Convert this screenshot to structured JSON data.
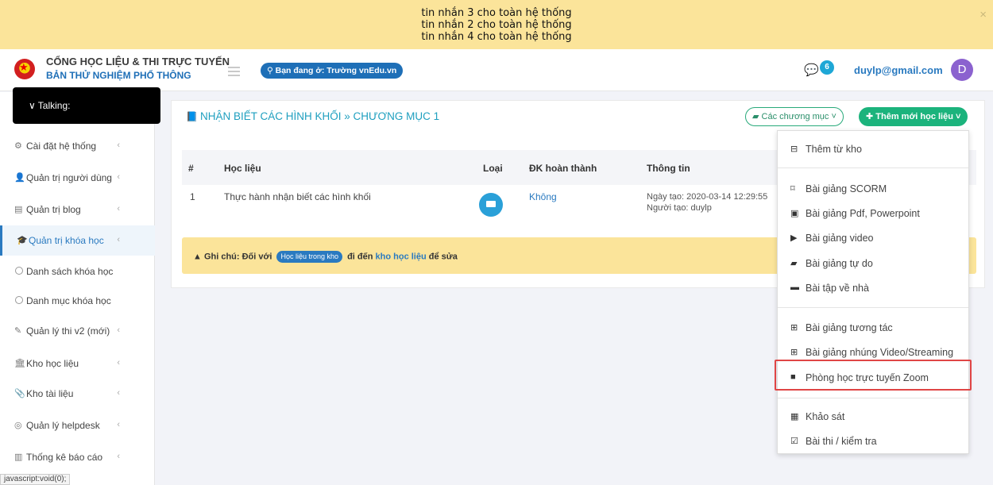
{
  "banner": {
    "lines": [
      "tin nhắn 3 cho toàn hệ thống",
      "tin nhắn 2 cho toàn hệ thống",
      "tin nhắn 4 cho toàn hệ thống"
    ],
    "close": "×"
  },
  "header": {
    "brand_line1": "CỔNG HỌC LIỆU & THI TRỰC TUYẾN",
    "brand_line2": "BẢN THỬ NGHIỆM PHỔ THÔNG",
    "location": "Bạn đang ở: Trường vnEdu.vn",
    "chat_count": "6",
    "user_email": "duylp@gmail.com",
    "avatar_letter": "D"
  },
  "sidebar": {
    "talking": "Talking:",
    "items": [
      {
        "label": "Cài đặt hệ thống",
        "icon": "gear-icon"
      },
      {
        "label": "Quản trị người dùng",
        "icon": "user-icon"
      },
      {
        "label": "Quản trị blog",
        "icon": "newspaper-icon"
      },
      {
        "label": "Quản trị khóa học",
        "icon": "graduation-cap-icon"
      },
      {
        "label": "Quản lý thi v2 (mới)",
        "icon": "edit-icon"
      },
      {
        "label": "Kho học liệu",
        "icon": "bank-icon"
      },
      {
        "label": "Kho tài liệu",
        "icon": "paperclip-icon"
      },
      {
        "label": "Quản lý helpdesk",
        "icon": "lifebuoy-icon"
      },
      {
        "label": "Thống kê báo cáo",
        "icon": "bar-chart-icon"
      }
    ],
    "subitems": [
      "Danh sách khóa học",
      "Danh mục khóa học"
    ],
    "arrow": "‹"
  },
  "statusbar": "javascript:void(0);",
  "main": {
    "breadcrumb": "NHẬN BIẾT CÁC HÌNH KHỐI » CHƯƠNG MỤC 1",
    "chapters_button": "Các chương mục",
    "add_button": "Thêm mới học liệu",
    "table": {
      "headers": [
        "#",
        "Học liệu",
        "Loại",
        "ĐK hoàn thành",
        "Thông tin"
      ],
      "rows": [
        {
          "index": "1",
          "name": "Thực hành nhận biết các hình khối",
          "type_icon": "presentation-icon",
          "completion": "Không",
          "created": "Ngày tạo: 2020-03-14 12:29:55",
          "creator": "Người tạo: duylp"
        }
      ]
    },
    "note": {
      "prefix": "Ghi chú: Đối với",
      "pill": "Học liệu trong kho",
      "middle": "đi đến",
      "link": "kho học liệu",
      "suffix": "để sửa"
    }
  },
  "dropdown": {
    "items": [
      {
        "label": "Thêm từ kho",
        "icon": "archive-icon"
      },
      {
        "label": "Bài giảng SCORM",
        "icon": "bookmark-icon"
      },
      {
        "label": "Bài giảng Pdf, Powerpoint",
        "icon": "file-powerpoint-icon"
      },
      {
        "label": "Bài giảng video",
        "icon": "file-video-icon"
      },
      {
        "label": "Bài giảng tự do",
        "icon": "book-icon"
      },
      {
        "label": "Bài tập về nhà",
        "icon": "folder-open-icon"
      },
      {
        "label": "Bài giảng tương tác",
        "icon": "interactive-icon"
      },
      {
        "label": "Bài giảng nhúng Video/Streaming",
        "icon": "embed-icon"
      },
      {
        "label": "Phòng học trực tuyến Zoom",
        "icon": "video-camera-icon"
      },
      {
        "label": "Khảo sát",
        "icon": "survey-icon"
      },
      {
        "label": "Bài thi / kiểm tra",
        "icon": "checkbox-icon"
      }
    ]
  },
  "colors": {
    "banner": "#fbe49a",
    "primary": "#2a7ac0",
    "green": "#1bb37c",
    "highlight": "#e04545"
  }
}
